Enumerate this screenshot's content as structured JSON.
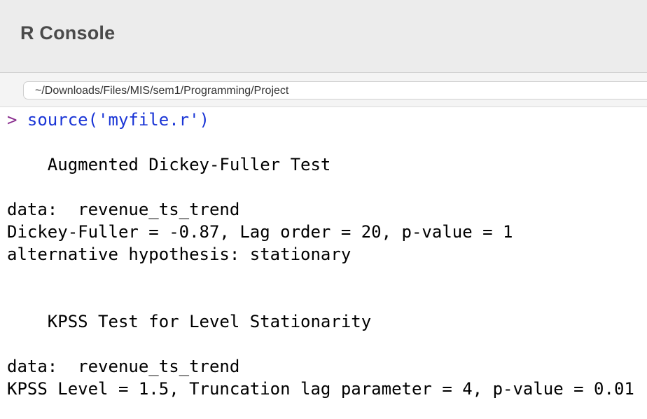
{
  "window": {
    "title": "R Console"
  },
  "path_bar": {
    "path": "~/Downloads/Files/MIS/sem1/Programming/Project"
  },
  "console": {
    "prompt": "> ",
    "command": "source('myfile.r')",
    "output": {
      "adf_title": "    Augmented Dickey-Fuller Test",
      "adf_data": "data:  revenue_ts_trend",
      "adf_stats": "Dickey-Fuller = -0.87, Lag order = 20, p-value = 1",
      "adf_alt": "alternative hypothesis: stationary",
      "kpss_title": "    KPSS Test for Level Stationarity",
      "kpss_data": "data:  revenue_ts_trend",
      "kpss_stats": "KPSS Level = 1.5, Truncation lag parameter = 4, p-value = 0.01"
    }
  },
  "colors": {
    "prompt": "#8a2f8f",
    "command": "#1a35d6",
    "titlebar_bg": "#ececec"
  }
}
